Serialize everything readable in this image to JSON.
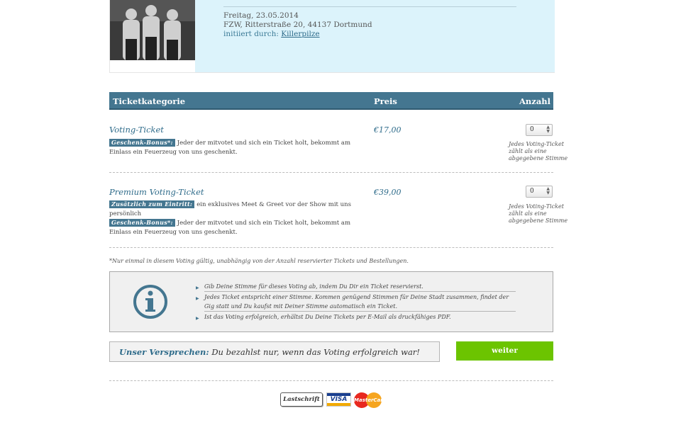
{
  "event": {
    "date": "Freitag, 23.05.2014",
    "venue": "FZW, Ritterstraße 20, 44137 Dortmund",
    "initiated_label": "initiiert durch:",
    "initiated_by": "Killerpilze"
  },
  "table": {
    "col_category": "Ticketkategorie",
    "col_price": "Preis",
    "col_qty": "Anzahl"
  },
  "tickets": [
    {
      "name": "Voting-Ticket",
      "price": "€17,00",
      "qty": "0",
      "qty_note": "Jedes Voting-Ticket zählt als eine abgegebene Stimme",
      "bonuses": [
        {
          "badge": "Geschenk-Bonus*:",
          "text": "Jeder der mitvotet und sich ein Ticket holt, bekommt am Einlass ein Feuerzeug von uns geschenkt."
        }
      ]
    },
    {
      "name": "Premium Voting-Ticket",
      "price": "€39,00",
      "qty": "0",
      "qty_note": "Jedes Voting-Ticket zählt als eine abgegebene Stimme",
      "bonuses": [
        {
          "badge": "Zusätzlich zum Eintritt:",
          "text": "ein exklusives Meet & Greet vor der Show mit uns persönlich"
        },
        {
          "badge": "Geschenk-Bonus*:",
          "text": "Jeder der mitvotet und sich ein Ticket holt, bekommt am Einlass ein Feuerzeug von uns geschenkt."
        }
      ]
    }
  ],
  "footnote": "*Nur einmal in diesem Voting gültig, unabhängig von der Anzahl reservierter Tickets und Bestellungen.",
  "info": {
    "icon": "info-icon",
    "items": [
      "Gib Deine Stimme für dieses Voting ab, indem Du Dir ein Ticket reservierst.",
      "Jedes Ticket entspricht einer Stimme. Kommen genügend Stimmen für Deine Stadt zusammen, findet der Gig statt und Du kaufst mit Deiner Stimme automatisch ein Ticket.",
      "Ist das Voting erfolgreich, erhältst Du Deine Tickets per E-Mail als druckfähiges PDF."
    ]
  },
  "promise": {
    "label": "Unser Versprechen:",
    "text": "Du bezahlst nur, wenn das Voting erfolgreich war!"
  },
  "actions": {
    "next": "weiter"
  },
  "payment": {
    "lastschrift": "Lastschrift",
    "visa": "VISA",
    "mastercard": "MasterCard"
  },
  "colors": {
    "accent": "#447690",
    "header_bg": "#dcf3fb",
    "button": "#6cc400"
  }
}
